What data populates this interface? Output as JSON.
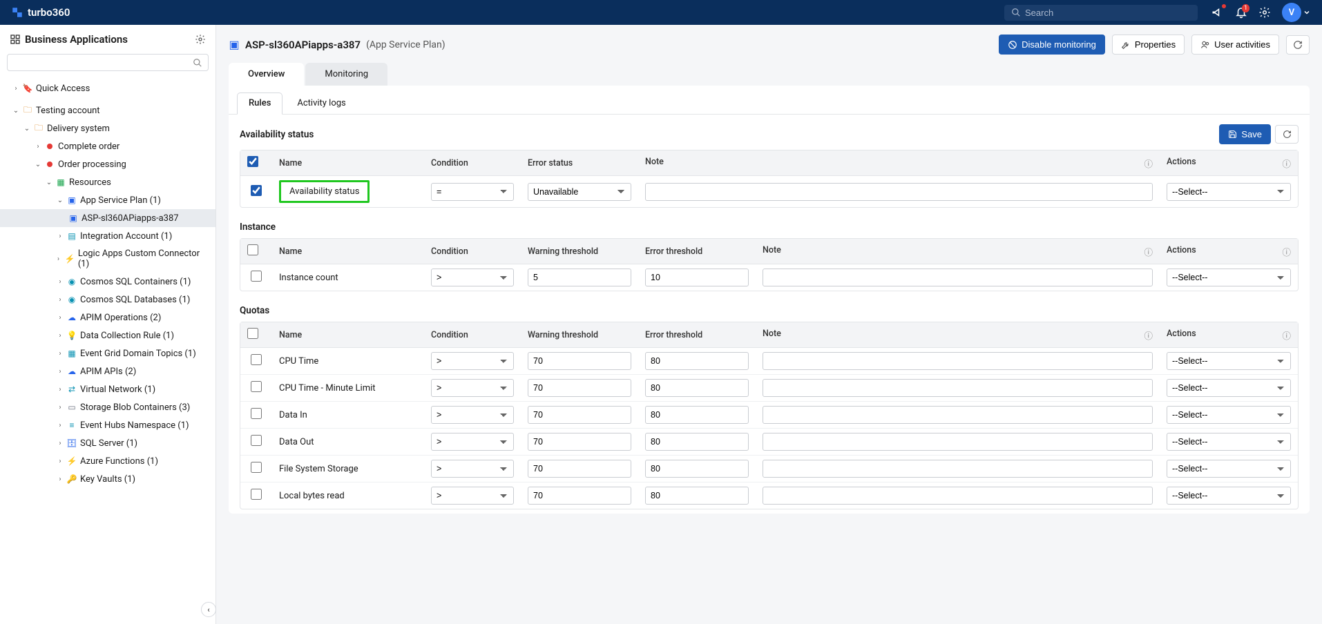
{
  "brand": "turbo360",
  "search_placeholder": "Search",
  "notif_badge": "1",
  "avatar_initial": "V",
  "sidebar": {
    "title": "Business Applications",
    "quick_access": "Quick Access",
    "nodes": {
      "testing": "Testing account",
      "delivery": "Delivery system",
      "complete": "Complete order",
      "orderproc": "Order processing",
      "resources": "Resources",
      "asp_plan": "App Service Plan (1)",
      "asp_item": "ASP-sl360APiapps-a387",
      "integ": "Integration Account (1)",
      "lacc": "Logic Apps Custom Connector (1)",
      "cosql_c": "Cosmos SQL Containers (1)",
      "cosql_d": "Cosmos SQL Databases (1)",
      "apim_op": "APIM Operations (2)",
      "dcr": "Data Collection Rule (1)",
      "egdt": "Event Grid Domain Topics (1)",
      "apim_api": "APIM APIs (2)",
      "vnet": "Virtual Network (1)",
      "sblob": "Storage Blob Containers (3)",
      "ehns": "Event Hubs Namespace (1)",
      "sqls": "SQL Server (1)",
      "azf": "Azure Functions (1)",
      "kv": "Key Vaults (1)"
    }
  },
  "page": {
    "title": "ASP-sl360APiapps-a387",
    "subtitle": "(App Service Plan)",
    "btn_disable": "Disable monitoring",
    "btn_props": "Properties",
    "btn_users": "User activities",
    "tab_overview": "Overview",
    "tab_monitoring": "Monitoring",
    "itab_rules": "Rules",
    "itab_activity": "Activity logs",
    "btn_save": "Save"
  },
  "sections": {
    "avail_title": "Availability status",
    "instance_title": "Instance",
    "quotas_title": "Quotas"
  },
  "headers": {
    "name": "Name",
    "condition": "Condition",
    "error_status": "Error status",
    "warning_threshold": "Warning threshold",
    "error_threshold": "Error threshold",
    "note": "Note",
    "actions": "Actions"
  },
  "avail_row": {
    "name": "Availability status",
    "condition": "=",
    "error_status": "Unavailable",
    "note": "",
    "action": "--Select--"
  },
  "instance_row": {
    "name": "Instance count",
    "condition": ">",
    "warn": "5",
    "err": "10",
    "note": "",
    "action": "--Select--"
  },
  "quotas": [
    {
      "name": "CPU Time",
      "cond": ">",
      "warn": "70",
      "err": "80",
      "act": "--Select--"
    },
    {
      "name": "CPU Time - Minute Limit",
      "cond": ">",
      "warn": "70",
      "err": "80",
      "act": "--Select--"
    },
    {
      "name": "Data In",
      "cond": ">",
      "warn": "70",
      "err": "80",
      "act": "--Select--"
    },
    {
      "name": "Data Out",
      "cond": ">",
      "warn": "70",
      "err": "80",
      "act": "--Select--"
    },
    {
      "name": "File System Storage",
      "cond": ">",
      "warn": "70",
      "err": "80",
      "act": "--Select--"
    },
    {
      "name": "Local bytes read",
      "cond": ">",
      "warn": "70",
      "err": "80",
      "act": "--Select--"
    }
  ]
}
